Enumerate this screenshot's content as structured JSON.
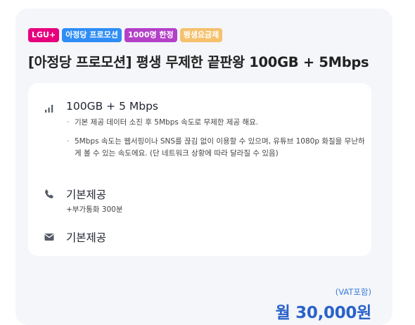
{
  "badges": [
    "LGU+",
    "아정당 프로모션",
    "1000명 한정",
    "평생요금제"
  ],
  "title": "[아정당 프로모션] 평생 무제한 끝판왕 100GB + 5Mbps",
  "data_section": {
    "icon": "signal-bars-icon",
    "heading": "100GB + 5 Mbps",
    "bullets": [
      "기본 제공 데이터 소진 후 5Mbps 속도로 무제한 제공 해요.",
      "5Mbps 속도는 웹서핑이나 SNS를 끊김 없이 이용할 수 있으며, 유튜브 1080p 화질을 무난하게 볼 수 있는 속도에요. (단 네트워크 상황에 따라 달라질 수 있음)"
    ]
  },
  "voice_section": {
    "icon": "phone-icon",
    "heading": "기본제공",
    "sub": "+부가통화 300분"
  },
  "sms_section": {
    "icon": "envelope-icon",
    "heading": "기본제공"
  },
  "price": {
    "vat_label": "(VAT포함)",
    "amount": "월 30,000원"
  },
  "colors": {
    "badge_lgu": "#e6007e",
    "badge_promo": "#2f8df5",
    "badge_limited": "#b440c8",
    "badge_lifetime": "#f5c16d",
    "price": "#2a62c9"
  }
}
